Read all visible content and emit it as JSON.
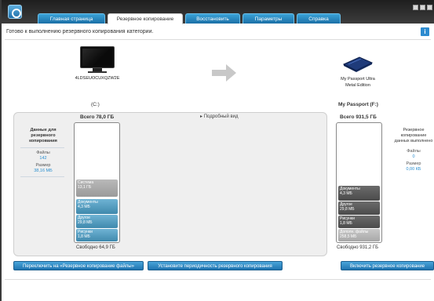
{
  "nav": {
    "tabs": [
      {
        "label": "Главная страница"
      },
      {
        "label": "Резервное копирование"
      },
      {
        "label": "Восстановить"
      },
      {
        "label": "Параметры"
      },
      {
        "label": "Справка"
      }
    ],
    "active_tab": 1
  },
  "status": {
    "text": "Готово к выполнению резервного копирования категории.",
    "info_glyph": "i"
  },
  "source": {
    "device_name": "4LDSEUOCUXQZW2E",
    "drive_label": "(C:)",
    "total": "Всего 78,0 ГБ",
    "free": "Свободно 64,9 ГБ",
    "summary": {
      "title": "Данные для резервного копирования",
      "files_label": "Файлы",
      "files_value": "142",
      "size_label": "Размер",
      "size_value": "38,16 МБ"
    },
    "segments": [
      {
        "name": "Система",
        "value": "13,1 ГБ"
      },
      {
        "name": "Документы",
        "value": "4,3 МБ"
      },
      {
        "name": "Другое",
        "value": "29,8 МБ"
      },
      {
        "name": "Рисунки",
        "value": "1,8 МБ"
      }
    ]
  },
  "detail_link": "Подробный вид",
  "target": {
    "device_name_line1": "My Passport Ultra",
    "device_name_line2": "Metal Edition",
    "drive_label": "My Passport (F:)",
    "total": "Всего 931,5 ГБ",
    "free": "Свободно 931,2 ГБ",
    "summary": {
      "title": "Резервное копирование данных выполнено",
      "files_label": "Файлы",
      "files_value": "0",
      "size_label": "Размер",
      "size_value": "0,00 КБ"
    },
    "segments": [
      {
        "name": "Документы",
        "value": "4,3 МБ"
      },
      {
        "name": "Другое",
        "value": "29,8 МБ"
      },
      {
        "name": "Рисунки",
        "value": "1,8 МБ"
      },
      {
        "name": "Дополн. файлы",
        "value": "258,5 МБ"
      }
    ]
  },
  "buttons": {
    "switch_file_backup": "Переключить на «Резервное копирование файлы»",
    "set_frequency": "Установите периодичность резервного копирования",
    "enable_backup": "Включить резервное копирование"
  },
  "colors": {
    "tab_blue": "#2a8fd0",
    "accent_value": "#2a8fd0",
    "segment_blue": "#4f97bb",
    "segment_gray": "#a6a6a6"
  },
  "icons": [
    "app-logo-icon",
    "monitor-icon",
    "arrow-right-icon",
    "external-drive-icon",
    "info-icon",
    "triangle-right-icon"
  ]
}
